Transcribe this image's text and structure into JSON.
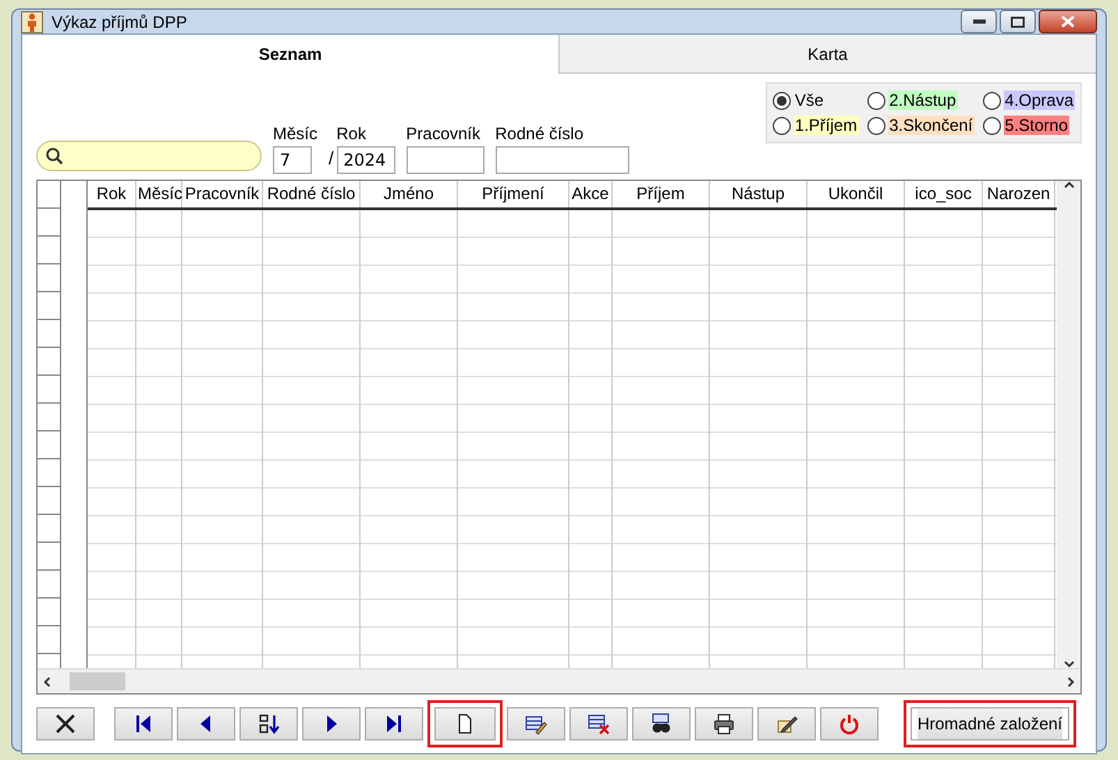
{
  "window": {
    "title": "Výkaz příjmů DPP"
  },
  "tabs": [
    {
      "label": "Seznam",
      "selected": true
    },
    {
      "label": "Karta",
      "selected": false
    }
  ],
  "filters": {
    "month": {
      "label": "Měsíc",
      "value": "7"
    },
    "separator": "/",
    "year": {
      "label": "Rok",
      "value": "2024"
    },
    "worker": {
      "label": "Pracovník"
    },
    "birth_number": {
      "label": "Rodné číslo"
    }
  },
  "status_options": [
    {
      "label": "Vše",
      "selected": true
    },
    {
      "label": "1.Příjem",
      "selected": false,
      "color": "#ffffc0"
    },
    {
      "label": "2.Nástup",
      "selected": false,
      "color": "#c0ffc0"
    },
    {
      "label": "3.Skončení",
      "selected": false,
      "color": "#ffe0c0"
    },
    {
      "label": "4.Oprava",
      "selected": false,
      "color": "#c8c8ff"
    },
    {
      "label": "5.Storno",
      "selected": false,
      "color": "#ff8080"
    }
  ],
  "table": {
    "columns": [
      "Rok",
      "Měsíc",
      "Pracovník",
      "Rodné číslo",
      "Jméno",
      "Příjmení",
      "Akce",
      "Příjem",
      "Nástup",
      "Ukončil",
      "ico_soc",
      "Narozen"
    ]
  },
  "toolbar": [
    {
      "kind": "cancel",
      "highlighted": false
    },
    {
      "kind": "first",
      "highlighted": false
    },
    {
      "kind": "prev",
      "highlighted": false
    },
    {
      "kind": "sort",
      "highlighted": false
    },
    {
      "kind": "next",
      "highlighted": false
    },
    {
      "kind": "last",
      "highlighted": false
    },
    {
      "kind": "new",
      "highlighted": true
    },
    {
      "kind": "edit",
      "highlighted": false
    },
    {
      "kind": "delete",
      "highlighted": false
    },
    {
      "kind": "find",
      "highlighted": false
    },
    {
      "kind": "print",
      "highlighted": false
    },
    {
      "kind": "tool",
      "highlighted": false
    },
    {
      "kind": "power",
      "highlighted": false
    }
  ],
  "bulk_button": {
    "label": "Hromadné založení",
    "highlighted": true
  }
}
